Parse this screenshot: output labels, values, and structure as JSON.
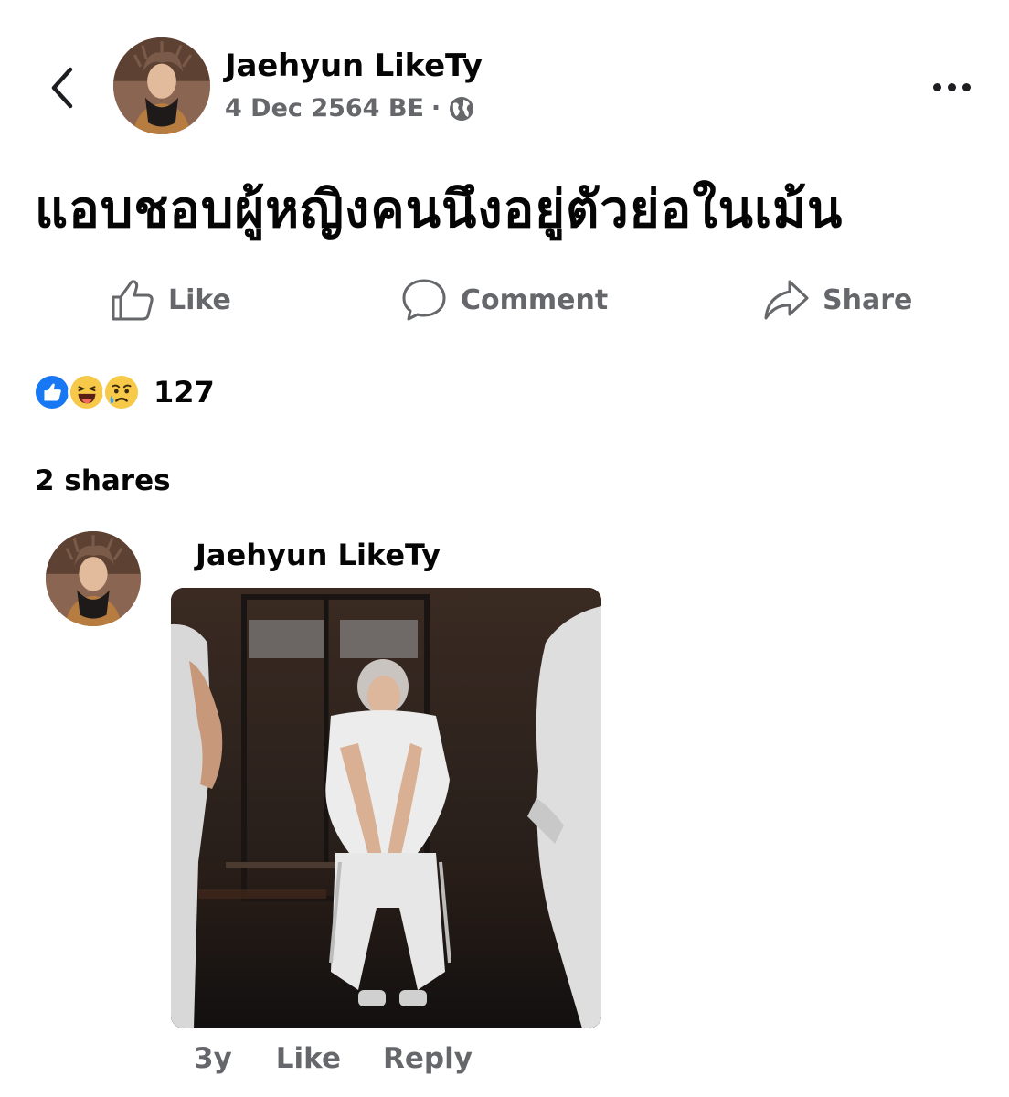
{
  "post": {
    "author": "Jaehyun LikeTy",
    "date": "4 Dec 2564 BE",
    "separator": "·",
    "text": "แอบชอบผู้หญิงคนนึงอยู่ตัวย่อในเม้น"
  },
  "actions": {
    "like": "Like",
    "comment": "Comment",
    "share": "Share"
  },
  "reactions": {
    "icons": [
      "like-reaction",
      "haha-reaction",
      "sad-reaction"
    ],
    "count": "127"
  },
  "shares": "2 shares",
  "comment": {
    "author": "Jaehyun LikeTy",
    "time": "3y",
    "like": "Like",
    "reply": "Reply"
  },
  "colors": {
    "text_primary": "#050505",
    "text_secondary": "#65676b",
    "like_blue": "#1877f2",
    "reaction_yellow": "#f7c948"
  }
}
